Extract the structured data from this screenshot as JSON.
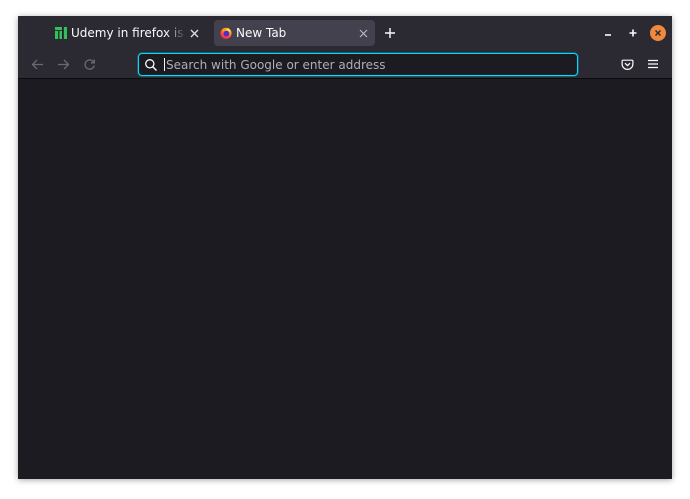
{
  "browser": {
    "tabs": [
      {
        "title": "Udemy in firefox is glitch",
        "favicon": "manjaro-icon",
        "active": false
      },
      {
        "title": "New Tab",
        "favicon": "firefox-icon",
        "active": true
      }
    ],
    "urlbar": {
      "placeholder": "Search with Google or enter address",
      "value": ""
    },
    "toolbar_icons": [
      "back-arrow-icon",
      "forward-arrow-icon",
      "reload-icon",
      "search-icon",
      "pocket-icon",
      "hamburger-menu-icon"
    ],
    "window_controls": [
      "minimize-icon",
      "maximize-icon",
      "close-icon"
    ]
  },
  "colors": {
    "frame": "#2b2a33",
    "active_tab": "#42414d",
    "content_bg": "#1c1b22",
    "focus_ring": "#00ddff",
    "close_button": "#f0883e",
    "manjaro_green": "#35bf5c"
  }
}
